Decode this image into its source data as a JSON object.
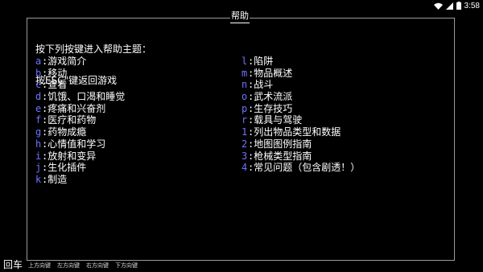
{
  "status_bar": {
    "time": "3:58"
  },
  "dialog": {
    "title": "帮助",
    "intro_line1": "按下列按键进入帮助主题：",
    "intro_line2": "按ESC\"键返回游戏"
  },
  "topics_left": [
    {
      "key": "a",
      "label": "游戏简介"
    },
    {
      "key": "b",
      "label": "移动"
    },
    {
      "key": "c",
      "label": "查看"
    },
    {
      "key": "d",
      "label": "饥饿、口渴和睡觉"
    },
    {
      "key": "e",
      "label": "疼痛和兴奋剂"
    },
    {
      "key": "f",
      "label": "医疗和药物"
    },
    {
      "key": "g",
      "label": "药物成瘾"
    },
    {
      "key": "h",
      "label": "心情值和学习"
    },
    {
      "key": "i",
      "label": "放射和变异"
    },
    {
      "key": "j",
      "label": "生化插件"
    },
    {
      "key": "k",
      "label": "制造"
    }
  ],
  "topics_right": [
    {
      "key": "l",
      "label": "陷阱"
    },
    {
      "key": "m",
      "label": "物品概述"
    },
    {
      "key": "n",
      "label": "战斗"
    },
    {
      "key": "o",
      "label": "武术流派"
    },
    {
      "key": "p",
      "label": "生存技巧"
    },
    {
      "key": "r",
      "label": "载具与驾驶"
    },
    {
      "key": "1",
      "label": "列出物品类型和数据"
    },
    {
      "key": "2",
      "label": "地图图例指南"
    },
    {
      "key": "3",
      "label": "枪械类型指南"
    },
    {
      "key": "4",
      "label": "常见问题（包含剧透！）"
    }
  ],
  "bottom_bar": {
    "enter_label": "回车",
    "arrow_keys": [
      "上方向键",
      "左方向键",
      "右方向键",
      "下方向键"
    ]
  }
}
